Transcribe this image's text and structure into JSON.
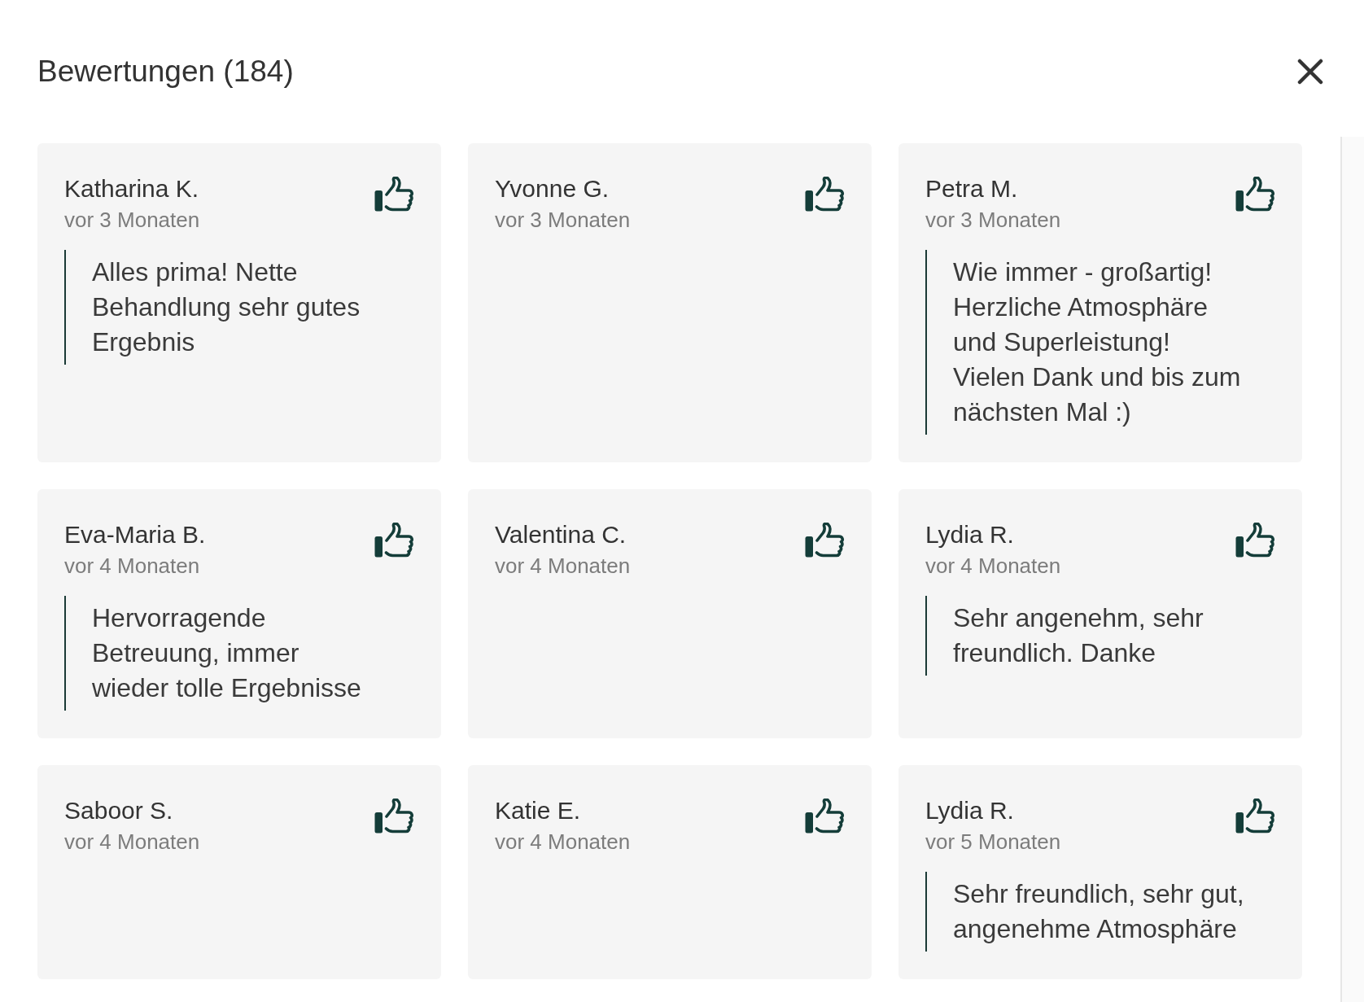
{
  "dialog": {
    "title": "Bewertungen (184)"
  },
  "reviews": [
    {
      "name": "Katharina K.",
      "time": "vor 3 Monaten",
      "text": "Alles prima! Nette\nBehandlung sehr gutes\nErgebnis"
    },
    {
      "name": "Yvonne G.",
      "time": "vor 3 Monaten"
    },
    {
      "name": "Petra M.",
      "time": "vor 3 Monaten",
      "text": "Wie immer - großartig!\nHerzliche Atmosphäre\nund Superleistung!\nVielen Dank und bis zum\nnächsten Mal :)"
    },
    {
      "name": "Eva-Maria B.",
      "time": "vor 4 Monaten",
      "text": "Hervorragende\nBetreuung, immer\nwieder tolle Ergebnisse"
    },
    {
      "name": "Valentina C.",
      "time": "vor 4 Monaten"
    },
    {
      "name": "Lydia R.",
      "time": "vor 4 Monaten",
      "text": "Sehr angenehm, sehr\nfreundlich. Danke"
    },
    {
      "name": "Saboor S.",
      "time": "vor 4 Monaten"
    },
    {
      "name": "Katie E.",
      "time": "vor 4 Monaten"
    },
    {
      "name": "Lydia R.",
      "time": "vor 5 Monaten",
      "text": "Sehr freundlich, sehr gut,\nangenehme Atmosphäre"
    }
  ]
}
